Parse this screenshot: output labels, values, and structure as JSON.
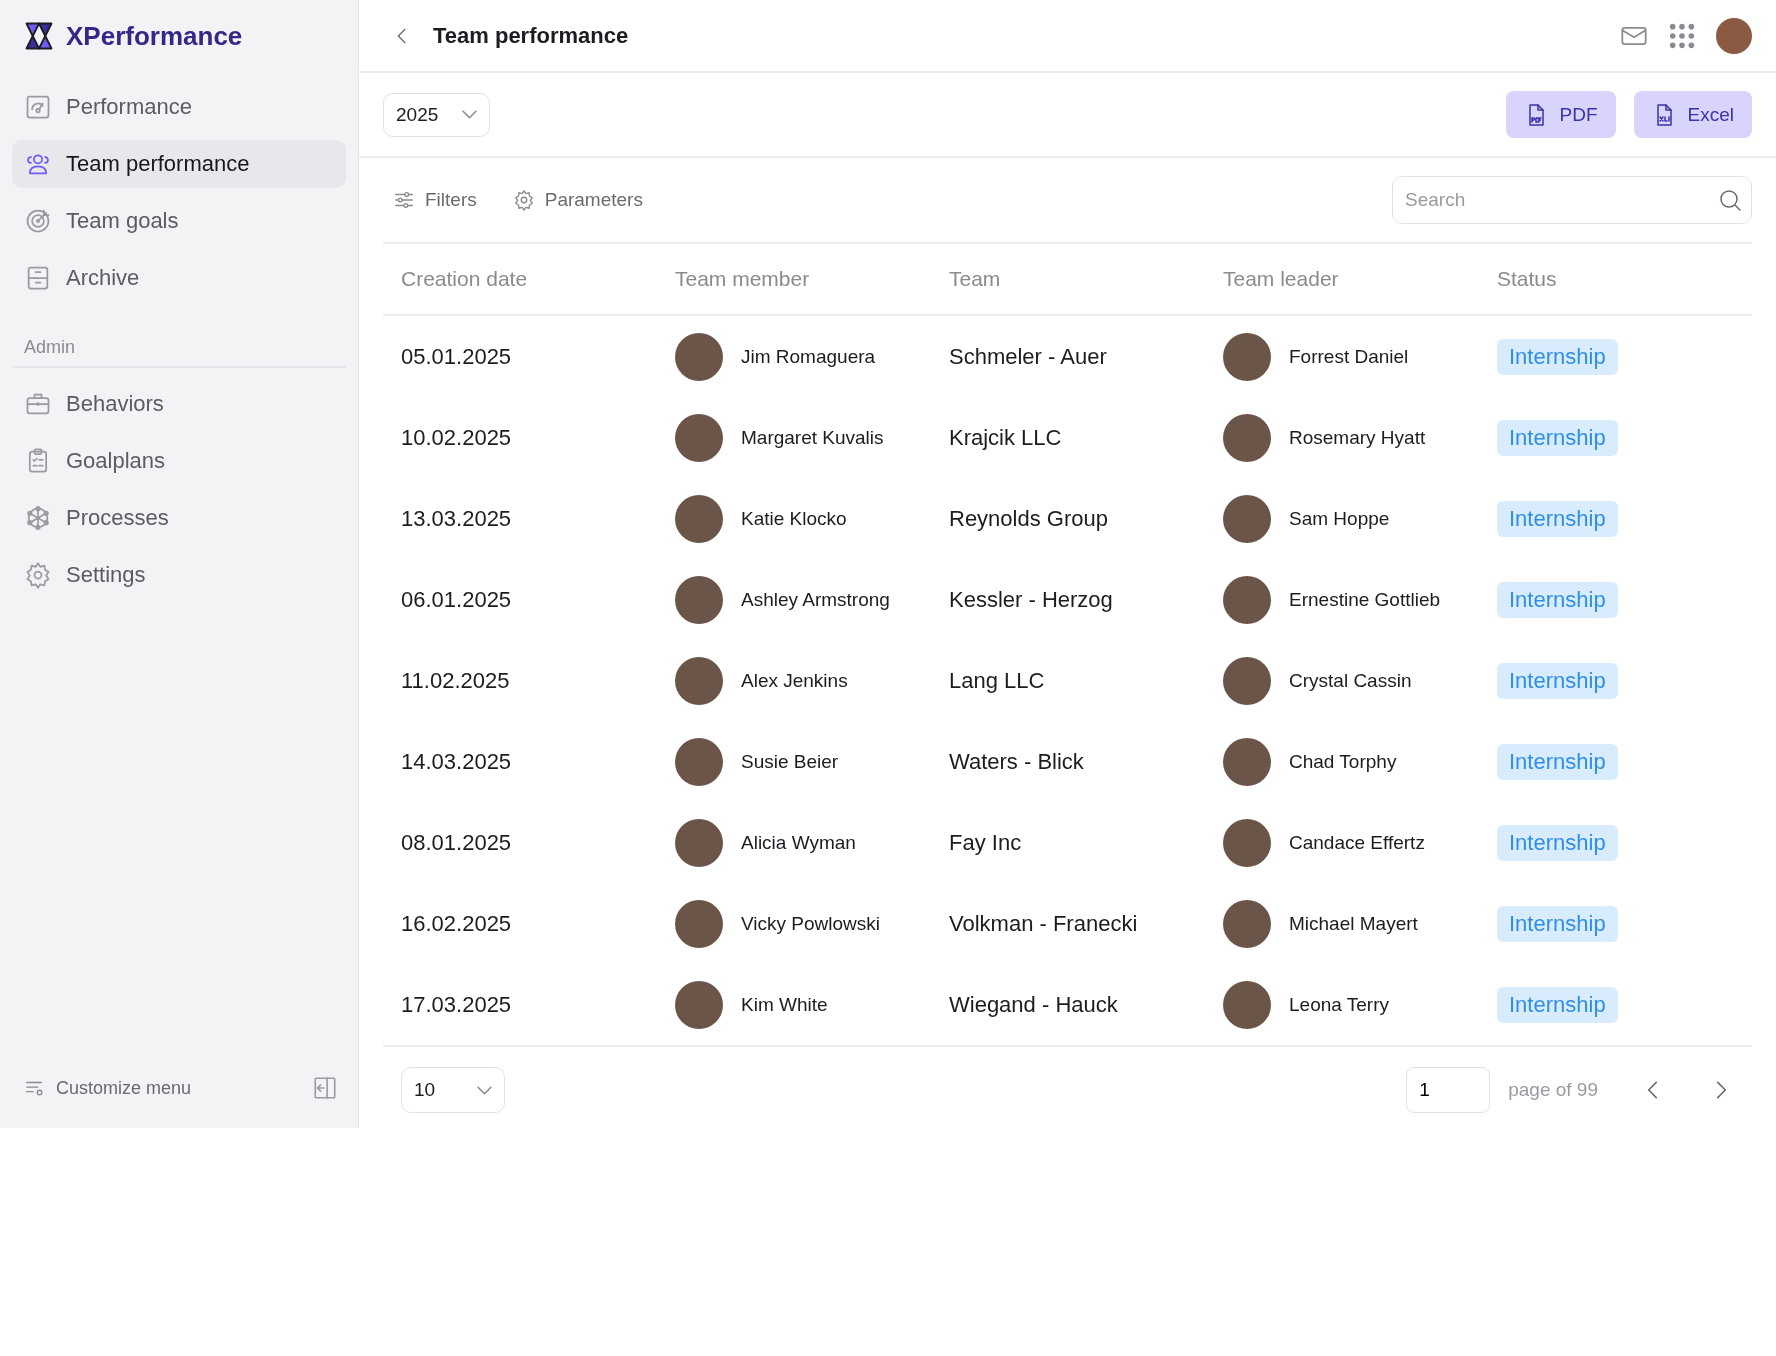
{
  "brand": "XPerformance",
  "sidebar": {
    "items": [
      {
        "label": "Performance",
        "selected": false
      },
      {
        "label": "Team performance",
        "selected": true
      },
      {
        "label": "Team goals",
        "selected": false
      },
      {
        "label": "Archive",
        "selected": false
      }
    ],
    "section": "Admin",
    "admin_items": [
      {
        "label": "Behaviors",
        "selected": false
      },
      {
        "label": "Goalplans",
        "selected": false
      },
      {
        "label": "Processes",
        "selected": false
      },
      {
        "label": "Settings",
        "selected": false
      }
    ],
    "customize": "Customize menu"
  },
  "header": {
    "title": "Team performance"
  },
  "year_select": {
    "value": "2025"
  },
  "export_buttons": [
    {
      "label": "PDF"
    },
    {
      "label": "Excel"
    }
  ],
  "toolbar": {
    "filters": "Filters",
    "parameters": "Parameters",
    "search": {
      "placeholder": "Search"
    }
  },
  "table": {
    "columns": [
      "Creation date",
      "Team member",
      "Team",
      "Team leader",
      "Status"
    ],
    "rows": [
      {
        "date": "05.01.2025",
        "member": "Jim Romaguera",
        "team": "Schmeler - Auer",
        "leader": "Forrest Daniel",
        "status": "Internship"
      },
      {
        "date": "10.02.2025",
        "member": "Margaret Kuvalis",
        "team": "Krajcik LLC",
        "leader": "Rosemary Hyatt",
        "status": "Internship"
      },
      {
        "date": "13.03.2025",
        "member": "Katie Klocko",
        "team": "Reynolds Group",
        "leader": "Sam Hoppe",
        "status": "Internship"
      },
      {
        "date": "06.01.2025",
        "member": "Ashley Armstrong",
        "team": "Kessler - Herzog",
        "leader": "Ernestine Gottlieb",
        "status": "Internship"
      },
      {
        "date": "11.02.2025",
        "member": "Alex Jenkins",
        "team": "Lang LLC",
        "leader": "Crystal Cassin",
        "status": "Internship"
      },
      {
        "date": "14.03.2025",
        "member": "Susie Beier",
        "team": "Waters - Blick",
        "leader": "Chad Torphy",
        "status": "Internship"
      },
      {
        "date": "08.01.2025",
        "member": "Alicia Wyman",
        "team": "Fay Inc",
        "leader": "Candace Effertz",
        "status": "Internship"
      },
      {
        "date": "16.02.2025",
        "member": "Vicky Powlowski",
        "team": "Volkman - Franecki",
        "leader": "Michael Mayert",
        "status": "Internship"
      },
      {
        "date": "17.03.2025",
        "member": "Kim White",
        "team": "Wiegand - Hauck",
        "leader": "Leona Terry",
        "status": "Internship"
      }
    ]
  },
  "pagination": {
    "page_size": "10",
    "page": "1",
    "page_label": "page of 99"
  }
}
